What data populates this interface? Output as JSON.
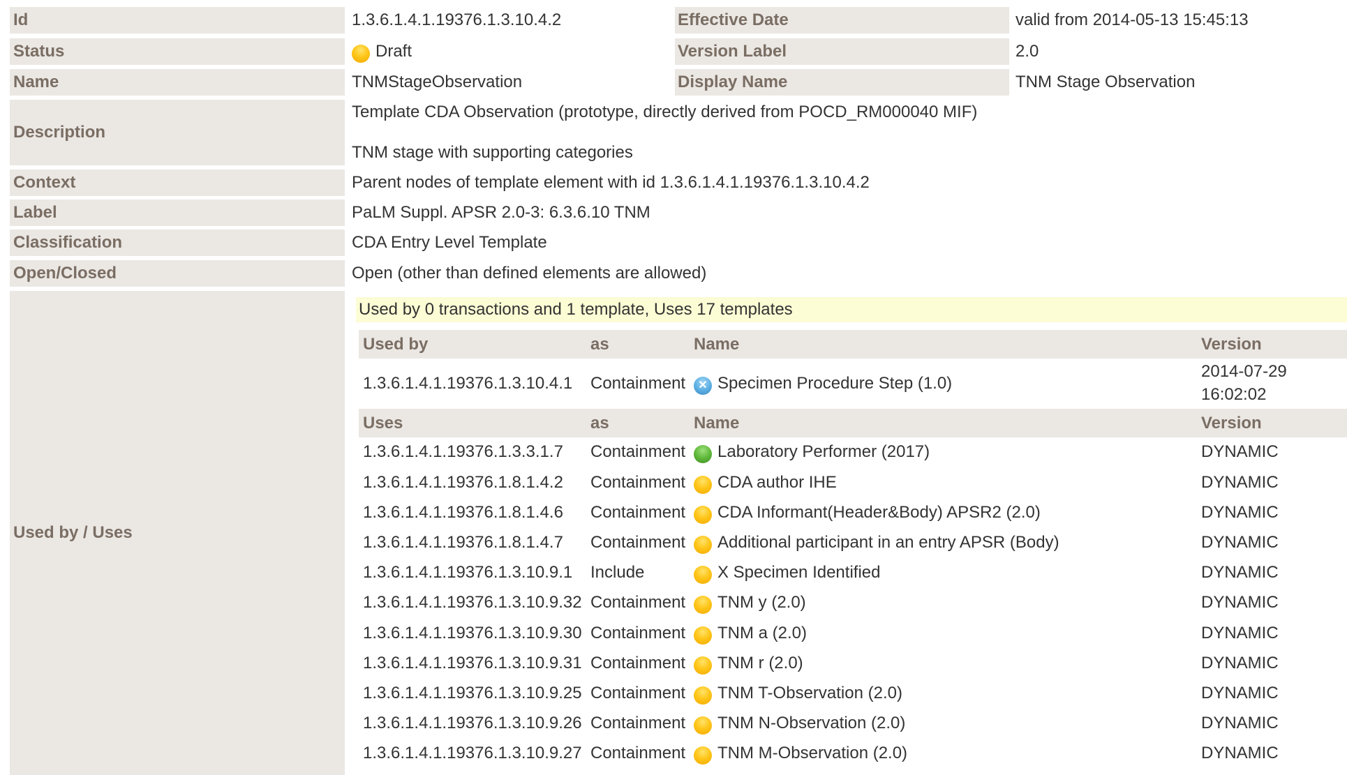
{
  "fields": {
    "id": {
      "label": "Id",
      "value": "1.3.6.1.4.1.19376.1.3.10.4.2"
    },
    "effective_date": {
      "label": "Effective Date",
      "value": "valid from 2014-05-13 15:45:13"
    },
    "status": {
      "label": "Status",
      "value": "Draft",
      "icon": "draft-status-icon"
    },
    "version_label": {
      "label": "Version Label",
      "value": "2.0"
    },
    "name": {
      "label": "Name",
      "value": "TNMStageObservation"
    },
    "display_name": {
      "label": "Display Name",
      "value": "TNM Stage Observation"
    },
    "description": {
      "label": "Description",
      "line1": "Template CDA Observation (prototype, directly derived from POCD_RM000040 MIF)",
      "line2": "TNM stage with supporting categories"
    },
    "context": {
      "label": "Context",
      "value": "Parent nodes of template element with id 1.3.6.1.4.1.19376.1.3.10.4.2"
    },
    "label": {
      "label": "Label",
      "value": "PaLM Suppl. APSR 2.0-3: 6.3.6.10 TNM"
    },
    "classification": {
      "label": "Classification",
      "value": "CDA Entry Level Template"
    },
    "open_closed": {
      "label": "Open/Closed",
      "value": "Open (other than defined elements are allowed)"
    },
    "used_by_uses": {
      "label": "Used by / Uses"
    }
  },
  "usage": {
    "summary": "Used by 0 transactions and 1 template, Uses 17 templates",
    "used_by_header": {
      "col1": "Used by",
      "col2": "as",
      "col3": "Name",
      "col4": "Version"
    },
    "used_by_rows": [
      {
        "id": "1.3.6.1.4.1.19376.1.3.10.4.1",
        "as": "Containment",
        "status": "retired",
        "name": "Specimen Procedure Step (1.0)",
        "version_date": "2014-07-29",
        "version_time": "16:02:02"
      }
    ],
    "uses_header": {
      "col1": "Uses",
      "col2": "as",
      "col3": "Name",
      "col4": "Version"
    },
    "uses_rows": [
      {
        "id": "1.3.6.1.4.1.19376.1.3.3.1.7",
        "as": "Containment",
        "status": "active",
        "name": "Laboratory Performer (2017)",
        "version": "DYNAMIC"
      },
      {
        "id": "1.3.6.1.4.1.19376.1.8.1.4.2",
        "as": "Containment",
        "status": "draft",
        "name": "CDA author IHE",
        "version": "DYNAMIC"
      },
      {
        "id": "1.3.6.1.4.1.19376.1.8.1.4.6",
        "as": "Containment",
        "status": "draft",
        "name": "CDA Informant(Header&Body) APSR2 (2.0)",
        "version": "DYNAMIC"
      },
      {
        "id": "1.3.6.1.4.1.19376.1.8.1.4.7",
        "as": "Containment",
        "status": "draft",
        "name": "Additional participant in an entry APSR (Body)",
        "version": "DYNAMIC"
      },
      {
        "id": "1.3.6.1.4.1.19376.1.3.10.9.1",
        "as": "Include",
        "status": "draft",
        "name": "X Specimen Identified",
        "version": "DYNAMIC"
      },
      {
        "id": "1.3.6.1.4.1.19376.1.3.10.9.32",
        "as": "Containment",
        "status": "draft",
        "name": "TNM y (2.0)",
        "version": "DYNAMIC"
      },
      {
        "id": "1.3.6.1.4.1.19376.1.3.10.9.30",
        "as": "Containment",
        "status": "draft",
        "name": "TNM a (2.0)",
        "version": "DYNAMIC"
      },
      {
        "id": "1.3.6.1.4.1.19376.1.3.10.9.31",
        "as": "Containment",
        "status": "draft",
        "name": "TNM r (2.0)",
        "version": "DYNAMIC"
      },
      {
        "id": "1.3.6.1.4.1.19376.1.3.10.9.25",
        "as": "Containment",
        "status": "draft",
        "name": "TNM T-Observation (2.0)",
        "version": "DYNAMIC"
      },
      {
        "id": "1.3.6.1.4.1.19376.1.3.10.9.26",
        "as": "Containment",
        "status": "draft",
        "name": "TNM N-Observation (2.0)",
        "version": "DYNAMIC"
      },
      {
        "id": "1.3.6.1.4.1.19376.1.3.10.9.27",
        "as": "Containment",
        "status": "draft",
        "name": "TNM M-Observation (2.0)",
        "version": "DYNAMIC"
      }
    ]
  },
  "colors": {
    "label_bg": "#ebe7e3",
    "label_text": "#7a6e64",
    "banner_bg": "#fcfcd5",
    "draft": "#ffc61a",
    "active": "#5fb83a",
    "retired": "#5aaee2"
  }
}
